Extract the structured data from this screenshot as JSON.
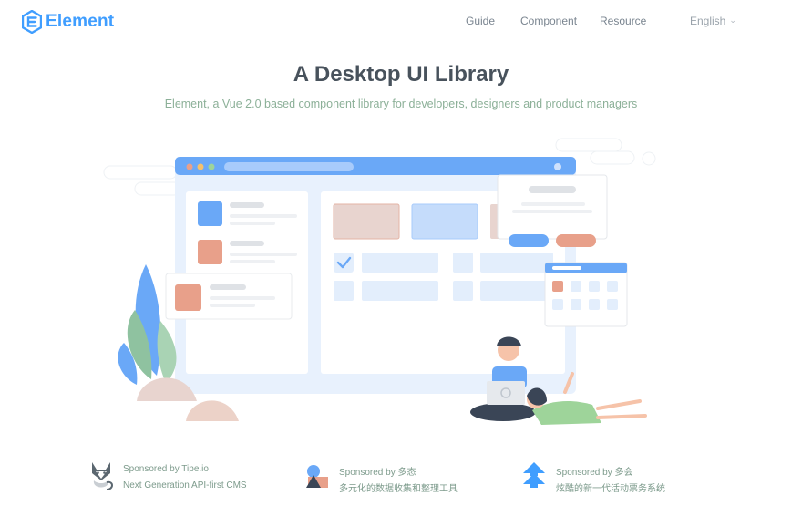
{
  "header": {
    "logo_text": "Element",
    "nav": {
      "guide": "Guide",
      "component": "Component",
      "resource": "Resource",
      "language": "English"
    }
  },
  "hero": {
    "title": "A Desktop UI Library",
    "subtitle": "Element, a Vue 2.0 based component library for developers, designers and product managers"
  },
  "sponsors": [
    {
      "title": "Sponsored by Tipe.io",
      "description": "Next Generation API-first CMS",
      "icon": "fox-icon"
    },
    {
      "title": "Sponsored by 多态",
      "description": "多元化的数据收集和整理工具",
      "icon": "shapes-icon"
    },
    {
      "title": "Sponsored by 多会",
      "description": "炫酷的新一代活动票务系统",
      "icon": "arrow-stack-icon"
    }
  ],
  "colors": {
    "brand": "#409eff",
    "illustration_blue": "#6aa8f7",
    "illustration_red": "#e8a08a",
    "subtitle_green": "#8cb098"
  }
}
